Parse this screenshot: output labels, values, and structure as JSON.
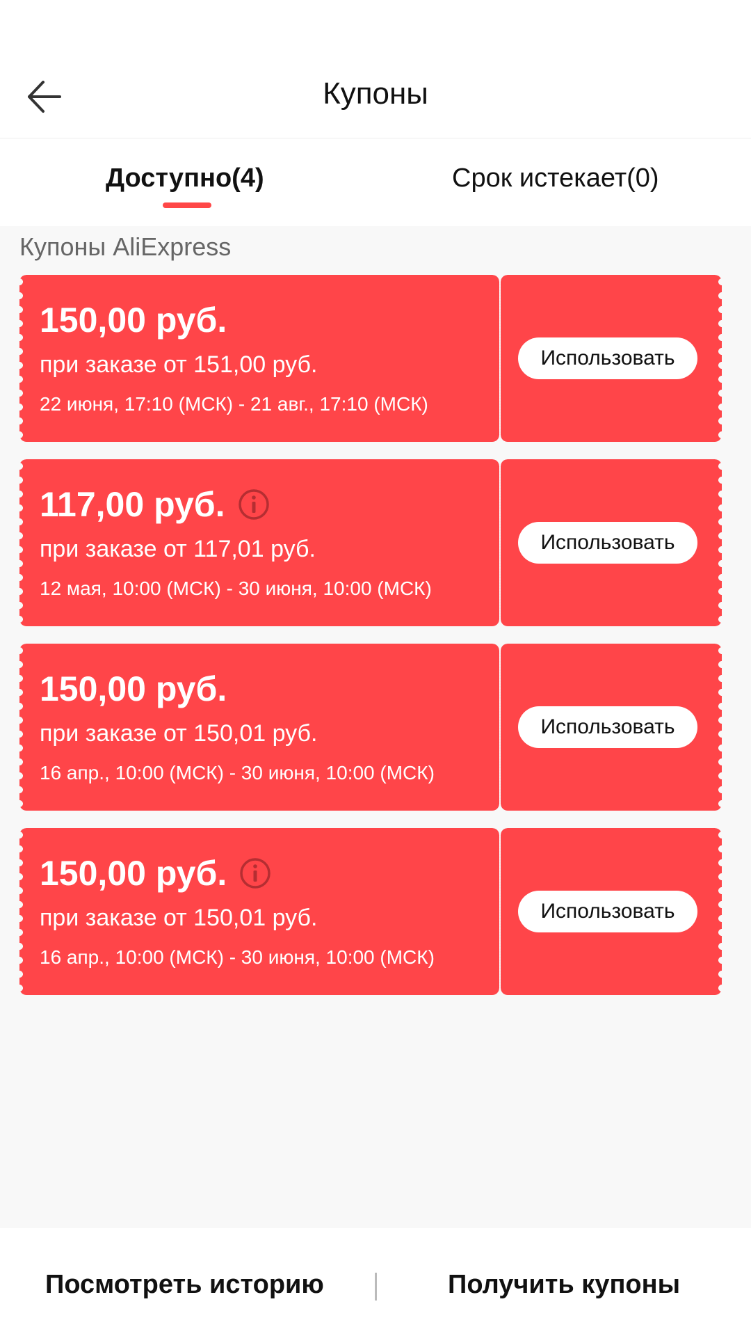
{
  "header": {
    "title": "Купоны",
    "back_icon": "arrow-left-icon"
  },
  "tabs": [
    {
      "label": "Доступно(4)",
      "active": true
    },
    {
      "label": "Срок истекает(0)",
      "active": false
    }
  ],
  "colors": {
    "accent": "#ff4747",
    "coupon": "#ff4549"
  },
  "section": {
    "label": "Купоны AliExpress"
  },
  "coupons": [
    {
      "amount": "150,00 руб.",
      "has_info": false,
      "condition": "при заказе от 151,00 руб.",
      "validity": "22 июня, 17:10 (МСК) - 21 авг., 17:10 (МСК)",
      "button": "Использовать"
    },
    {
      "amount": "117,00 руб.",
      "has_info": true,
      "condition": "при заказе от 117,01 руб.",
      "validity": "12 мая, 10:00 (МСК) - 30 июня, 10:00 (МСК)",
      "button": "Использовать"
    },
    {
      "amount": "150,00 руб.",
      "has_info": false,
      "condition": "при заказе от 150,01 руб.",
      "validity": "16 апр., 10:00 (МСК) - 30 июня, 10:00 (МСК)",
      "button": "Использовать"
    },
    {
      "amount": "150,00 руб.",
      "has_info": true,
      "condition": "при заказе от 150,01 руб.",
      "validity": "16 апр., 10:00 (МСК) - 30 июня, 10:00 (МСК)",
      "button": "Использовать"
    }
  ],
  "footer": {
    "history": "Посмотреть историю",
    "get_coupons": "Получить купоны"
  }
}
